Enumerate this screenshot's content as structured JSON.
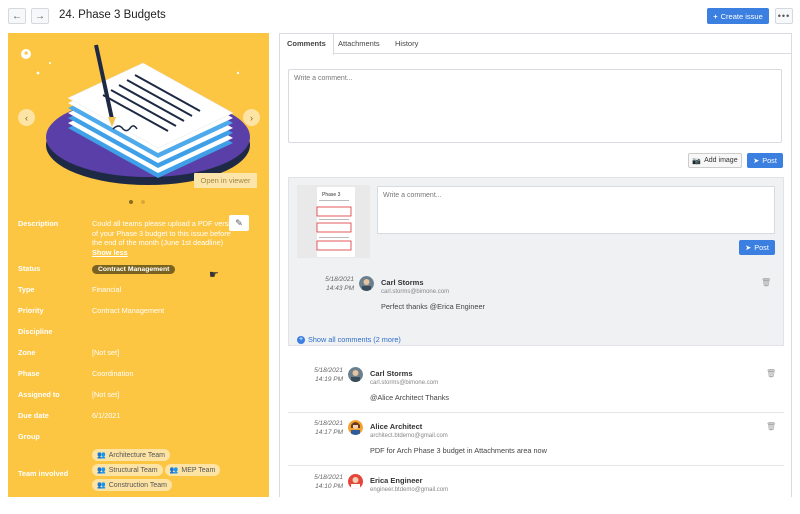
{
  "header": {
    "back_icon": "arrow-left-icon",
    "forward_icon": "arrow-right-icon",
    "title": "24. Phase 3 Budgets",
    "create_label": "Create issue",
    "more_icon": "ellipsis-icon"
  },
  "preview": {
    "open_viewer_label": "Open in viewer",
    "slide_count": 2,
    "active_slide": 1
  },
  "fields": {
    "description_label": "Description",
    "description_value": "Could all teams please upload a PDF versions of your Phase 3 budget to this issue before the end of the month (June 1st deadline)",
    "show_less": "Show less",
    "status_label": "Status",
    "status_value": "Contract Management",
    "type_label": "Type",
    "type_value": "Financial",
    "priority_label": "Priority",
    "priority_value": "Contract Management",
    "discipline_label": "Discipline",
    "discipline_value": "",
    "zone_label": "Zone",
    "zone_value": "[Not set]",
    "phase_label": "Phase",
    "phase_value": "Coordination",
    "assigned_label": "Assigned to",
    "assigned_value": "[Not set]",
    "due_label": "Due date",
    "due_value": "6/1/2021",
    "group_label": "Group",
    "team_label": "Team involved",
    "teams": [
      "Architecture Team",
      "Structural Team",
      "MEP Team",
      "Construction Team"
    ]
  },
  "tabs": [
    "Comments",
    "Attachments",
    "History"
  ],
  "composer": {
    "placeholder": "Write a comment...",
    "add_image_label": "Add image",
    "post_label": "Post"
  },
  "thread": {
    "placeholder": "Write a comment...",
    "post_label": "Post",
    "thumb_caption": "Phase 3",
    "reply": {
      "date": "5/18/2021",
      "time": "14:43 PM",
      "name": "Carl Storms",
      "email": "carl.storms@bimone.com",
      "text": "Perfect thanks @Erica Engineer"
    },
    "show_all_label": "Show all comments (2 more)"
  },
  "comments": [
    {
      "date": "5/18/2021",
      "time": "14:19 PM",
      "name": "Carl Storms",
      "email": "carl.storms@bimone.com",
      "text": "@Alice Architect Thanks"
    },
    {
      "date": "5/18/2021",
      "time": "14:17 PM",
      "name": "Alice Architect",
      "email": "architect.btdemo@gmail.com",
      "text": "PDF for Arch Phase 3 budget in Attachments area now"
    },
    {
      "date": "5/18/2021",
      "time": "14:10 PM",
      "name": "Erica Engineer",
      "email": "engineer.btdemo@gmail.com",
      "text": ""
    }
  ],
  "colors": {
    "panel_yellow": "#fcc542",
    "accent_blue": "#3b7fe0",
    "status_tag": "#7a6320"
  }
}
